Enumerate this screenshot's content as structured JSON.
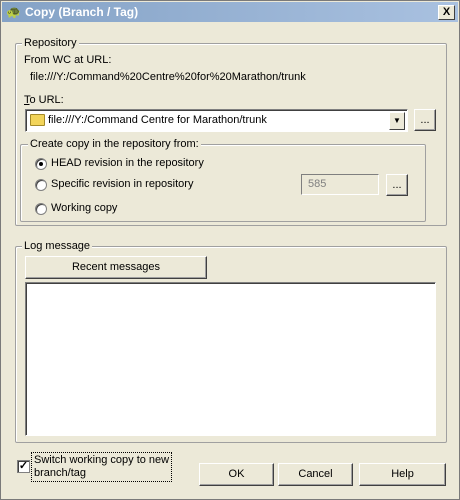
{
  "window": {
    "title": "Copy (Branch / Tag)",
    "close_label": "X"
  },
  "repository": {
    "group_label": "Repository",
    "from_label": "From WC at URL:",
    "from_url": "file:///Y:/Command%20Centre%20for%20Marathon/trunk",
    "to_label": "To URL:",
    "to_url_value": "file:///Y:/Command Centre for Marathon/trunk",
    "browse_label": "..."
  },
  "create_copy": {
    "group_label": "Create copy in the repository from:",
    "options": [
      {
        "label": "HEAD revision in the repository",
        "selected": true
      },
      {
        "label": "Specific revision in repository",
        "selected": false
      },
      {
        "label": "Working copy",
        "selected": false
      }
    ],
    "revision_value": "585",
    "revision_browse_label": "..."
  },
  "log": {
    "group_label": "Log message",
    "recent_messages_label": "Recent messages",
    "message_text": ""
  },
  "footer": {
    "switch_label": "Switch working copy to new branch/tag",
    "switch_checked": true,
    "ok_label": "OK",
    "cancel_label": "Cancel",
    "help_label": "Help"
  }
}
